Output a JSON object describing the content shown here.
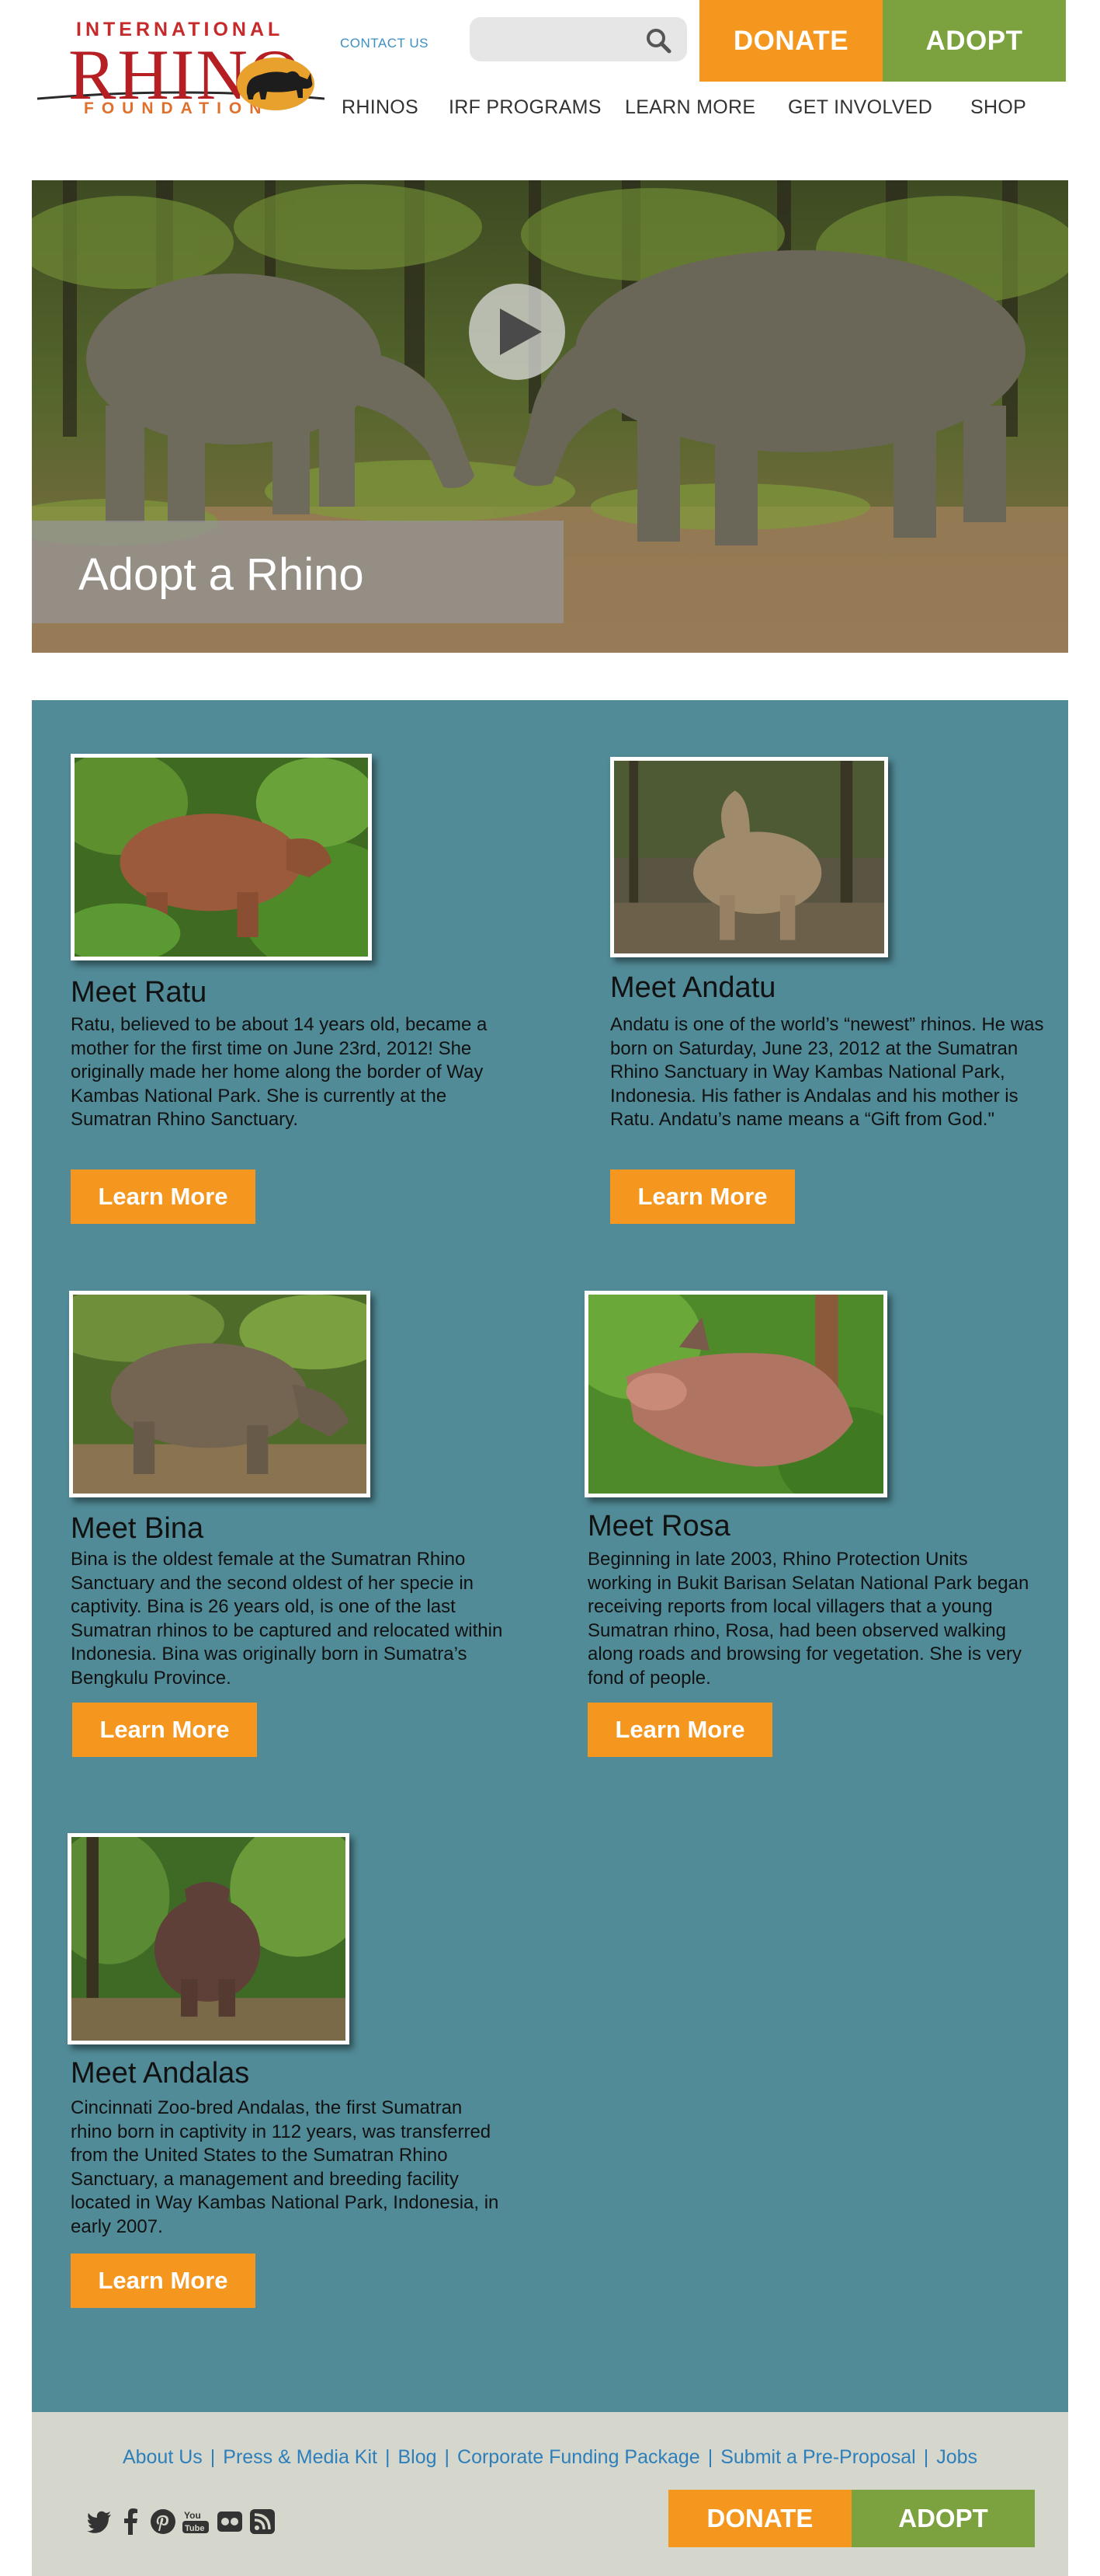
{
  "logo": {
    "line1": "INTERNATIONAL",
    "line2": "RHINO",
    "line3": "FOUNDATION"
  },
  "header": {
    "contact_label": "CONTACT US",
    "search_placeholder": "",
    "donate_label": "DONATE",
    "adopt_label": "ADOPT"
  },
  "nav": {
    "items": [
      "RHINOS",
      "IRF PROGRAMS",
      "LEARN MORE",
      "GET INVOLVED",
      "SHOP"
    ]
  },
  "hero": {
    "caption": "Adopt a Rhino"
  },
  "rhinos": [
    {
      "title": "Meet Ratu",
      "description": "Ratu, believed to be about 14 years old, became a mother for the first time on June 23rd, 2012! She originally made her home along the border of Way Kambas National Park. She is currently at the Sumatran Rhino Sanctuary.",
      "button": "Learn More"
    },
    {
      "title": "Meet Andatu",
      "description": "Andatu is one of the world’s “newest” rhinos. He was born on Saturday, June 23, 2012 at the Sumatran Rhino Sanctuary in Way Kambas National Park, Indonesia. His father is Andalas and his mother is Ratu. Andatu’s name means a “Gift from God.\"",
      "button": "Learn More"
    },
    {
      "title": "Meet Bina",
      "description": "Bina is the oldest female at the Sumatran Rhino Sanctuary and the second oldest of her specie in captivity. Bina is 26 years old, is one of the last Sumatran rhinos to be captured and relocated within Indonesia. Bina was originally born in Sumatra’s Bengkulu Province.",
      "button": "Learn More"
    },
    {
      "title": "Meet Rosa",
      "description": "Beginning in late 2003, Rhino Protection Units working in Bukit Barisan Selatan National Park began receiving reports from local villagers that a young Sumatran rhino, Rosa, had been observed walking along roads and browsing for vegetation. She is very fond of people.",
      "button": "Learn More"
    },
    {
      "title": "Meet Andalas",
      "description": "Cincinnati Zoo-bred Andalas, the first Sumatran rhino born in captivity in 112 years, was transferred from the United States to the Sumatran Rhino Sanctuary, a management and breeding facility located in Way Kambas National Park, Indonesia, in early 2007.",
      "button": "Learn More"
    }
  ],
  "footer": {
    "links": [
      "About Us",
      "Press & Media Kit",
      "Blog",
      "Corporate Funding Package",
      "Submit a Pre-Proposal",
      "Jobs"
    ],
    "separator": "|",
    "social_icons": [
      "twitter-icon",
      "facebook-icon",
      "pinterest-icon",
      "youtube-icon",
      "flickr-icon",
      "rss-icon"
    ],
    "donate_label": "DONATE",
    "adopt_label": "ADOPT"
  },
  "colors": {
    "orange": "#f5971f",
    "green": "#7ba23e",
    "teal_section": "#518b97",
    "footer_bg": "#d6d7cc",
    "link_blue": "#2d7fbb"
  }
}
